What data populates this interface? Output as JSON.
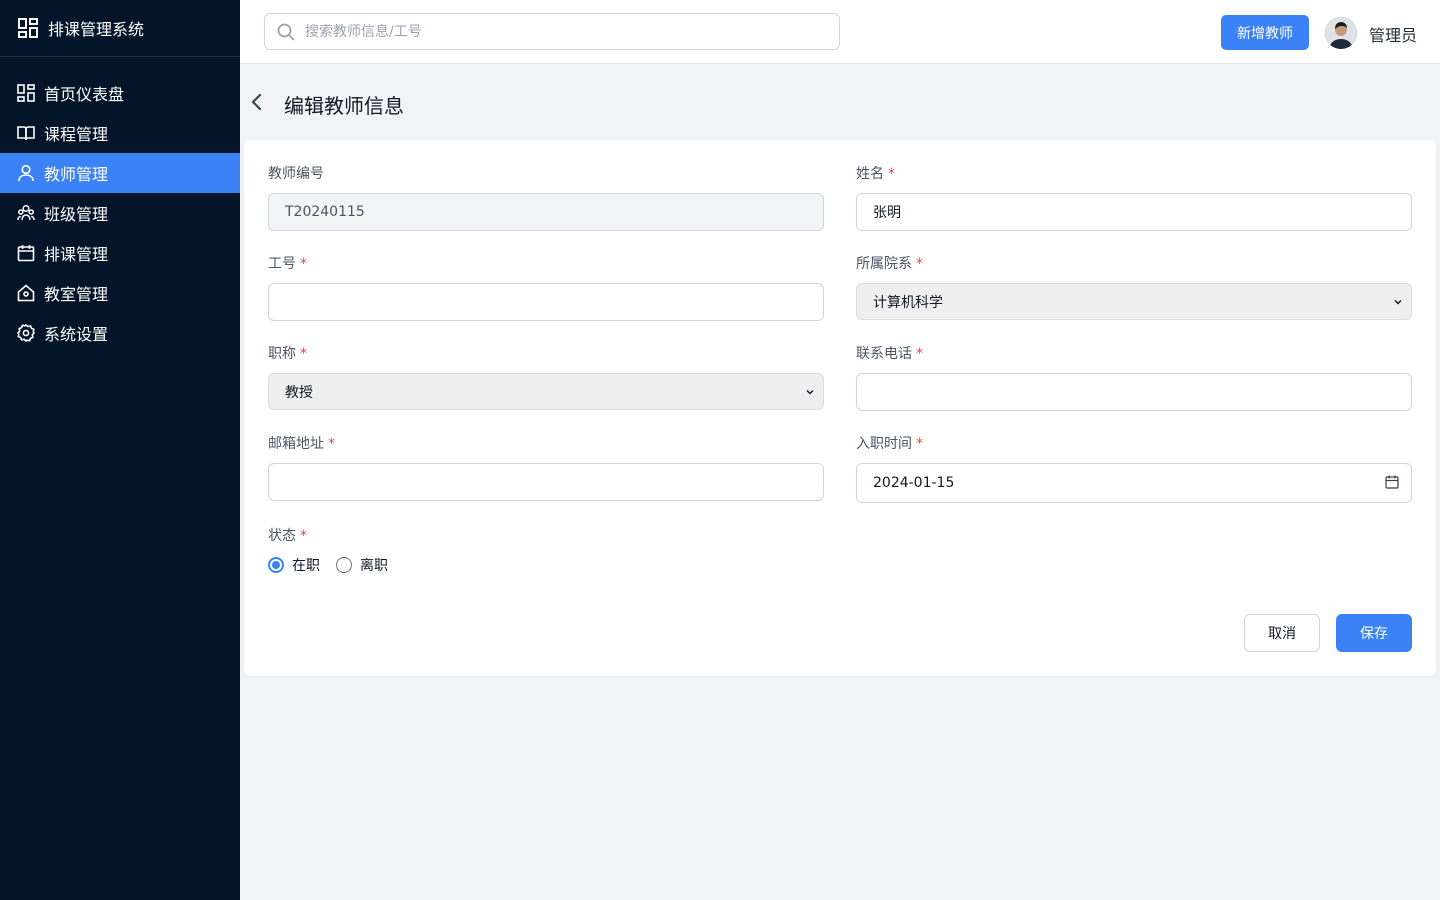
{
  "app": {
    "title": "排课管理系统"
  },
  "sidebar": {
    "items": [
      {
        "label": "首页仪表盘",
        "icon": "dashboard-icon",
        "active": false
      },
      {
        "label": "课程管理",
        "icon": "book-icon",
        "active": false
      },
      {
        "label": "教师管理",
        "icon": "user-icon",
        "active": true
      },
      {
        "label": "班级管理",
        "icon": "users-icon",
        "active": false
      },
      {
        "label": "排课管理",
        "icon": "calendar-icon",
        "active": false
      },
      {
        "label": "教室管理",
        "icon": "home-icon",
        "active": false
      },
      {
        "label": "系统设置",
        "icon": "gear-icon",
        "active": false
      }
    ]
  },
  "header": {
    "search_placeholder": "搜索教师信息/工号",
    "add_button": "新增教师",
    "user_name": "管理员"
  },
  "page": {
    "title": "编辑教师信息"
  },
  "form": {
    "teacher_id": {
      "label": "教师编号",
      "value": "T20240115",
      "required": false
    },
    "name": {
      "label": "姓名",
      "value": "张明",
      "required": true
    },
    "employee_no": {
      "label": "工号",
      "value": "",
      "required": true
    },
    "department": {
      "label": "所属院系",
      "value": "计算机科学",
      "required": true
    },
    "title": {
      "label": "职称",
      "value": "教授",
      "required": true
    },
    "phone": {
      "label": "联系电话",
      "value": "",
      "required": true
    },
    "email": {
      "label": "邮箱地址",
      "value": "",
      "required": true
    },
    "hire_date": {
      "label": "入职时间",
      "value": "2024-01-15",
      "required": true
    },
    "status": {
      "label": "状态",
      "required": true,
      "options": [
        "在职",
        "离职"
      ],
      "selected": "在职"
    },
    "required_mark": "*",
    "cancel_button": "取消",
    "save_button": "保存"
  },
  "colors": {
    "accent": "#3b82f6",
    "sidebar_bg": "#04152a",
    "required": "#ef4444"
  }
}
